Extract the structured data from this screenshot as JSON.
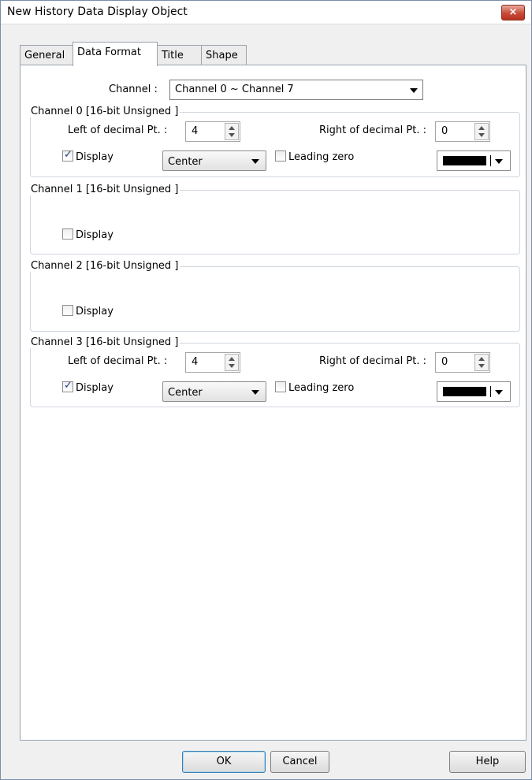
{
  "window": {
    "title": "New  History Data Display Object",
    "close_glyph": "×"
  },
  "tabs": [
    {
      "label": "General",
      "active": false
    },
    {
      "label": "Data Format",
      "active": true
    },
    {
      "label": "Title",
      "active": false
    },
    {
      "label": "Shape",
      "active": false
    }
  ],
  "channel_select": {
    "label": "Channel :",
    "value": "Channel 0 ~ Channel 7"
  },
  "groups": [
    {
      "title": "Channel 0 [16-bit Unsigned ]",
      "left_label": "Left of decimal Pt. :",
      "left_value": "4",
      "right_label": "Right of decimal Pt. :",
      "right_value": "0",
      "display_label": "Display",
      "display_checked": true,
      "align_value": "Center",
      "leading_zero_label": "Leading zero",
      "leading_zero_checked": false,
      "color": "#000000"
    },
    {
      "title": "Channel 1 [16-bit Unsigned ]",
      "display_label": "Display",
      "display_checked": false
    },
    {
      "title": "Channel 2 [16-bit Unsigned ]",
      "display_label": "Display",
      "display_checked": false
    },
    {
      "title": "Channel 3 [16-bit Unsigned ]",
      "left_label": "Left of decimal Pt. :",
      "left_value": "4",
      "right_label": "Right of decimal Pt. :",
      "right_value": "0",
      "display_label": "Display",
      "display_checked": true,
      "align_value": "Center",
      "leading_zero_label": "Leading zero",
      "leading_zero_checked": false,
      "color": "#000000"
    }
  ],
  "buttons": {
    "ok": "OK",
    "cancel": "Cancel",
    "help": "Help"
  }
}
